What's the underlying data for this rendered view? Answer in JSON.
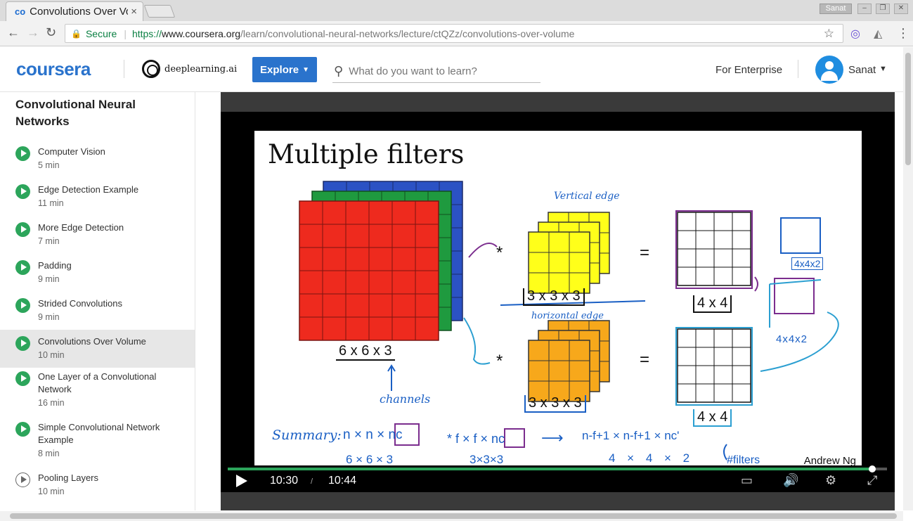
{
  "browser": {
    "tab_title": "Convolutions Over Volume",
    "tab_close": "×",
    "profile_name": "Sanat",
    "url_secure_label": "Secure",
    "url_scheme": "https://",
    "url_host": "www.coursera.org",
    "url_path": "/learn/convolutional-neural-networks/lecture/ctQZz/convolutions-over-volume"
  },
  "header": {
    "logo": "coursera",
    "partner": "deeplearning.ai",
    "explore_label": "Explore",
    "search_placeholder": "What do you want to learn?",
    "enterprise_link": "For Enterprise",
    "user_name": "Sanat"
  },
  "sidebar": {
    "course_title": "Convolutional Neural Networks",
    "lessons": [
      {
        "name": "Computer Vision",
        "duration": "5 min",
        "active": false
      },
      {
        "name": "Edge Detection Example",
        "duration": "11 min",
        "active": false
      },
      {
        "name": "More Edge Detection",
        "duration": "7 min",
        "active": false
      },
      {
        "name": "Padding",
        "duration": "9 min",
        "active": false
      },
      {
        "name": "Strided Convolutions",
        "duration": "9 min",
        "active": false
      },
      {
        "name": "Convolutions Over Volume",
        "duration": "10 min",
        "active": true
      },
      {
        "name": "One Layer of a Convolutional Network",
        "duration": "16 min",
        "active": false
      },
      {
        "name": "Simple Convolutional Network Example",
        "duration": "8 min",
        "active": false
      },
      {
        "name": "Pooling Layers",
        "duration": "10 min",
        "active": false
      }
    ]
  },
  "slide": {
    "title": "Multiple filters",
    "input_label": "6 x 6 x 3",
    "filter1_label": "3 x 3 x 3",
    "filter2_label": "3 x 3 x 3",
    "output1_label": "4 x 4",
    "output2_label": "4 x 4",
    "multiply_symbol": "*",
    "equals_symbol": "=",
    "author": "Andrew Ng",
    "annotations": {
      "vertical_edge": "Vertical edge",
      "horizontal_edge": "horizontal edge",
      "channels": "channels",
      "stack_label_top": "4x4x2",
      "stack_label_mid": "4x4x2",
      "summary_label": "Summary:",
      "summary_eq1": "n × n × nc",
      "summary_eq2": "* f × f × nc",
      "summary_arrow": "⟶",
      "summary_eq3": "n-f+1 × n-f+1 × nc'",
      "summary_sub1": "6 × 6 × 3",
      "summary_sub2": "3×3×3",
      "summary_sub3": "4 × 4 × 2",
      "summary_filters": "#filters"
    }
  },
  "player": {
    "current_time": "10:30",
    "time_separator": "/",
    "total_time": "10:44",
    "progress": 0.978
  },
  "colors": {
    "accent": "#2a73cc",
    "play_green": "#2ca55b",
    "active_row": "#e7e7e7",
    "ink_blue": "#1a5fc4",
    "ink_purple": "#7b2d8e",
    "ink_cyan": "#2b9fd1"
  }
}
